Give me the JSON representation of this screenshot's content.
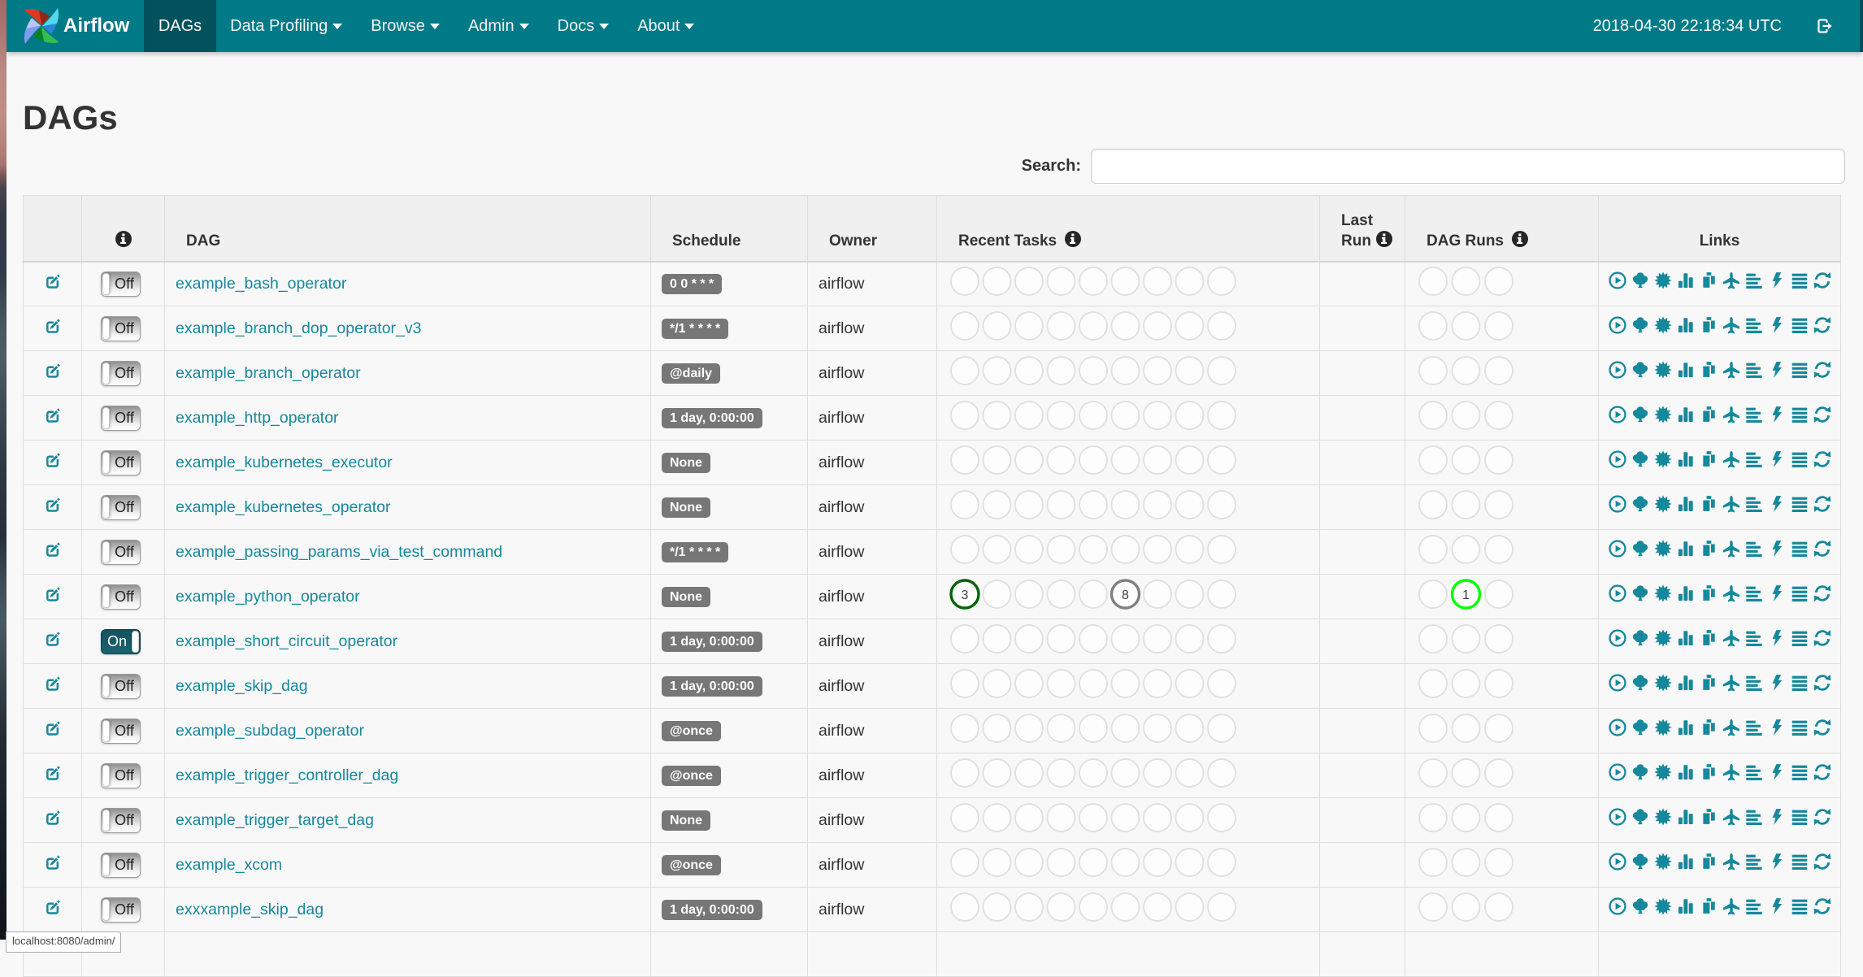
{
  "navbar": {
    "brand": "Airflow",
    "items": [
      {
        "label": "DAGs",
        "active": true,
        "dropdown": false
      },
      {
        "label": "Data Profiling",
        "active": false,
        "dropdown": true
      },
      {
        "label": "Browse",
        "active": false,
        "dropdown": true
      },
      {
        "label": "Admin",
        "active": false,
        "dropdown": true
      },
      {
        "label": "Docs",
        "active": false,
        "dropdown": true
      },
      {
        "label": "About",
        "active": false,
        "dropdown": true
      }
    ],
    "clock": "2018-04-30 22:18:34 UTC"
  },
  "page": {
    "title": "DAGs",
    "search_label": "Search:",
    "search_value": "",
    "status_tooltip": "localhost:8080/admin/"
  },
  "colors": {
    "navbar": "#007a87",
    "navbar_active": "#02525d",
    "link_teal": "#16889c",
    "badge_gray": "#777777",
    "state_success": "#006400",
    "state_running": "#00ff00",
    "state_queued": "#808080",
    "empty_circle": "#e0e0e0"
  },
  "table": {
    "headers": {
      "info": "info-icon",
      "dag": "DAG",
      "schedule": "Schedule",
      "owner": "Owner",
      "recent_tasks": "Recent Tasks",
      "last_run_line1": "Last",
      "last_run_line2": "Run",
      "dag_runs": "DAG Runs",
      "links": "Links"
    },
    "recent_task_slots": 9,
    "dag_run_slots": 3,
    "links_icons": [
      "play-circle",
      "tree",
      "certificate",
      "stats",
      "duplicate",
      "plane",
      "align-left",
      "flash",
      "align-justify",
      "refresh"
    ],
    "rows": [
      {
        "dag": "example_bash_operator",
        "toggle": "Off",
        "schedule": "0 0 * * *",
        "owner": "airflow",
        "last_run": "",
        "recent_tasks": [],
        "dag_runs": []
      },
      {
        "dag": "example_branch_dop_operator_v3",
        "toggle": "Off",
        "schedule": "*/1 * * * *",
        "owner": "airflow",
        "last_run": "",
        "recent_tasks": [],
        "dag_runs": []
      },
      {
        "dag": "example_branch_operator",
        "toggle": "Off",
        "schedule": "@daily",
        "owner": "airflow",
        "last_run": "",
        "recent_tasks": [],
        "dag_runs": []
      },
      {
        "dag": "example_http_operator",
        "toggle": "Off",
        "schedule": "1 day, 0:00:00",
        "owner": "airflow",
        "last_run": "",
        "recent_tasks": [],
        "dag_runs": []
      },
      {
        "dag": "example_kubernetes_executor",
        "toggle": "Off",
        "schedule": "None",
        "owner": "airflow",
        "last_run": "",
        "recent_tasks": [],
        "dag_runs": []
      },
      {
        "dag": "example_kubernetes_operator",
        "toggle": "Off",
        "schedule": "None",
        "owner": "airflow",
        "last_run": "",
        "recent_tasks": [],
        "dag_runs": []
      },
      {
        "dag": "example_passing_params_via_test_command",
        "toggle": "Off",
        "schedule": "*/1 * * * *",
        "owner": "airflow",
        "last_run": "",
        "recent_tasks": [],
        "dag_runs": []
      },
      {
        "dag": "example_python_operator",
        "toggle": "Off",
        "schedule": "None",
        "owner": "airflow",
        "last_run": "",
        "recent_tasks": [
          {
            "slot": 0,
            "count": 3,
            "state": "success"
          },
          {
            "slot": 5,
            "count": 8,
            "state": "queued"
          }
        ],
        "dag_runs": [
          {
            "slot": 1,
            "count": 1,
            "state": "running"
          }
        ]
      },
      {
        "dag": "example_short_circuit_operator",
        "toggle": "On",
        "schedule": "1 day, 0:00:00",
        "owner": "airflow",
        "last_run": "",
        "recent_tasks": [],
        "dag_runs": []
      },
      {
        "dag": "example_skip_dag",
        "toggle": "Off",
        "schedule": "1 day, 0:00:00",
        "owner": "airflow",
        "last_run": "",
        "recent_tasks": [],
        "dag_runs": []
      },
      {
        "dag": "example_subdag_operator",
        "toggle": "Off",
        "schedule": "@once",
        "owner": "airflow",
        "last_run": "",
        "recent_tasks": [],
        "dag_runs": []
      },
      {
        "dag": "example_trigger_controller_dag",
        "toggle": "Off",
        "schedule": "@once",
        "owner": "airflow",
        "last_run": "",
        "recent_tasks": [],
        "dag_runs": []
      },
      {
        "dag": "example_trigger_target_dag",
        "toggle": "Off",
        "schedule": "None",
        "owner": "airflow",
        "last_run": "",
        "recent_tasks": [],
        "dag_runs": []
      },
      {
        "dag": "example_xcom",
        "toggle": "Off",
        "schedule": "@once",
        "owner": "airflow",
        "last_run": "",
        "recent_tasks": [],
        "dag_runs": []
      },
      {
        "dag": "exxxample_skip_dag",
        "toggle": "Off",
        "schedule": "1 day, 0:00:00",
        "owner": "airflow",
        "last_run": "",
        "recent_tasks": [],
        "dag_runs": []
      }
    ],
    "partial_row": true
  }
}
